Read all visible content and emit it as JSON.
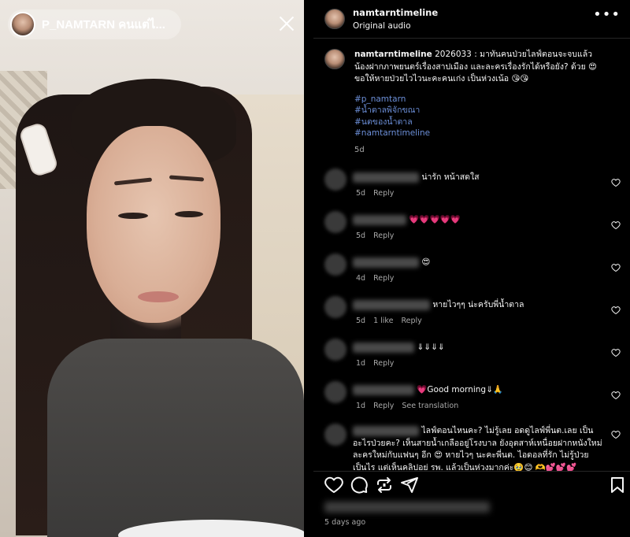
{
  "story": {
    "username": "P_NAMTARN คนแต่ไ..."
  },
  "post": {
    "username": "namtarntimeline",
    "audio": "Original audio",
    "caption": {
      "username": "namtarntimeline",
      "text": "2026033 : มาทันคนป่วยไลฟ์ตอนจะจบแล้ว น้องฝากภาพยนตร์เรื่องสาปเมือง และละครเรื่องรักได้หรือยัง? ด้วย 😍 ขอให้หายป่วยไวไวนะคะคนเก่ง เป็นห่วงเน้อ 😘😘",
      "hashtags": [
        "#p_namtarn",
        "#น้ำตาลพิจักขณา",
        "#นตของน้ำตาล",
        "#namtarntimeline"
      ],
      "age": "5d"
    },
    "comments": [
      {
        "text": "น่ารัก หน้าสดใส",
        "age": "5d",
        "likes": "",
        "reply": "Reply",
        "translate": ""
      },
      {
        "text": "💗💗💗💗💗",
        "age": "5d",
        "likes": "",
        "reply": "Reply",
        "translate": ""
      },
      {
        "text": "😍",
        "age": "4d",
        "likes": "",
        "reply": "Reply",
        "translate": ""
      },
      {
        "text": "หายไวๆๆ น่ะครับพี่น้ำตาล",
        "age": "5d",
        "likes": "1 like",
        "reply": "Reply",
        "translate": ""
      },
      {
        "text": "⇓⇓⇓⇓",
        "age": "1d",
        "likes": "",
        "reply": "Reply",
        "translate": ""
      },
      {
        "text": "💗Good morning⇓🙏",
        "age": "1d",
        "likes": "",
        "reply": "Reply",
        "translate": "See translation"
      },
      {
        "text": "ไลฟ์ตอนไหนคะ? ไม่รู้เลย อดดูไลฟ์พี่นต.เลย เป็นอะไรป่วยคะ? เห็นสายน้ำเกลืออยู่โรงบาล ยังอุตสาห์เหนื่อยฝากหนังใหม่ละครใหม่กับแฟนๆ อีก 😍 หายไวๆ นะคะพี่นต. ไอดอลที่รัก ไม่รู้ป่วยเป็นไร แต่เห็นคลิปอย่ รพ. แล้วเป็นห่วงมากค่ะ🥹😊 🫶💕💕💕"
      }
    ],
    "time_ago": "5 days ago"
  }
}
